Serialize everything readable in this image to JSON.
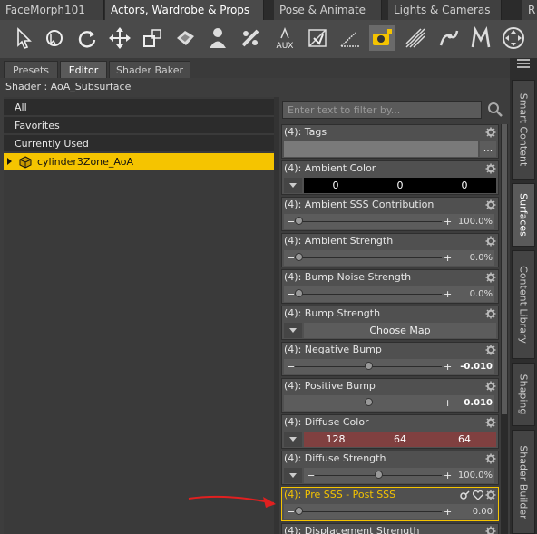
{
  "top_tabs": [
    {
      "label": "FaceMorph101",
      "active": false
    },
    {
      "label": "Actors, Wardrobe & Props",
      "active": true
    },
    {
      "label": "Pose & Animate",
      "active": false
    },
    {
      "label": "Lights & Cameras",
      "active": false
    },
    {
      "label": "R",
      "active": false
    }
  ],
  "toolbar": {
    "icons": [
      "node-selection-icon",
      "universal-rotate-icon",
      "rotate-icon",
      "translate-icon",
      "scale-icon",
      "surface-selection-icon",
      "figure-icon",
      "joint-editor-icon",
      "aux-viewport-icon",
      "geometry-editor-icon",
      "angle-icon",
      "camera-highlighted-icon",
      "spot-render-icon",
      "posing-tool-icon",
      "morph-icon",
      "orbit-icon"
    ],
    "aux_label": "AUX"
  },
  "subtabs": [
    "Presets",
    "Editor",
    "Shader Baker"
  ],
  "shader_title": "Shader : AoA_Subsurface",
  "left_list": {
    "items": [
      "All",
      "Favorites",
      "Currently Used"
    ],
    "selected": "cylinder3Zone_AoA"
  },
  "filter": {
    "placeholder": "Enter text to filter by..."
  },
  "properties": [
    {
      "label": "(4): Tags",
      "kind": "text",
      "button": "..."
    },
    {
      "label": "(4): Ambient Color",
      "kind": "color",
      "values": [
        "0",
        "0",
        "0"
      ],
      "color": "#000000"
    },
    {
      "label": "(4): Ambient SSS Contribution",
      "kind": "slider",
      "value": "100.0%",
      "knob": 0.0
    },
    {
      "label": "(4): Ambient Strength",
      "kind": "slider",
      "value": "0.0%",
      "knob": 0.0
    },
    {
      "label": "(4): Bump Noise Strength",
      "kind": "slider",
      "value": "0.0%",
      "knob": 0.0
    },
    {
      "label": "(4): Bump Strength",
      "kind": "map",
      "value": "Choose Map"
    },
    {
      "label": "(4): Negative Bump",
      "kind": "slider",
      "value": "-0.010",
      "knob": 0.5,
      "bold": true
    },
    {
      "label": "(4): Positive Bump",
      "kind": "slider",
      "value": "0.010",
      "knob": 0.5,
      "bold": true
    },
    {
      "label": "(4): Diffuse Color",
      "kind": "color",
      "values": [
        "128",
        "64",
        "64"
      ],
      "color": "#804040"
    },
    {
      "label": "(4): Diffuse Strength",
      "kind": "slider-dd",
      "value": "100.0%",
      "knob": 0.5
    },
    {
      "label": "(4): Pre SSS - Post SSS",
      "kind": "slider",
      "value": "0.00",
      "knob": 0.0,
      "highlighted": true
    },
    {
      "label": "(4): Displacement Strength",
      "kind": "slider",
      "value": "",
      "knob": 0.0
    }
  ],
  "vertical_tabs": [
    {
      "label": "Smart Content",
      "active": false
    },
    {
      "label": "Surfaces",
      "active": true
    },
    {
      "label": "Content Library",
      "active": false
    },
    {
      "label": "Shaping",
      "active": false
    },
    {
      "label": "Shader Builder",
      "active": false
    }
  ],
  "colors": {
    "accent": "#f5c400",
    "arrow": "#e02020"
  }
}
